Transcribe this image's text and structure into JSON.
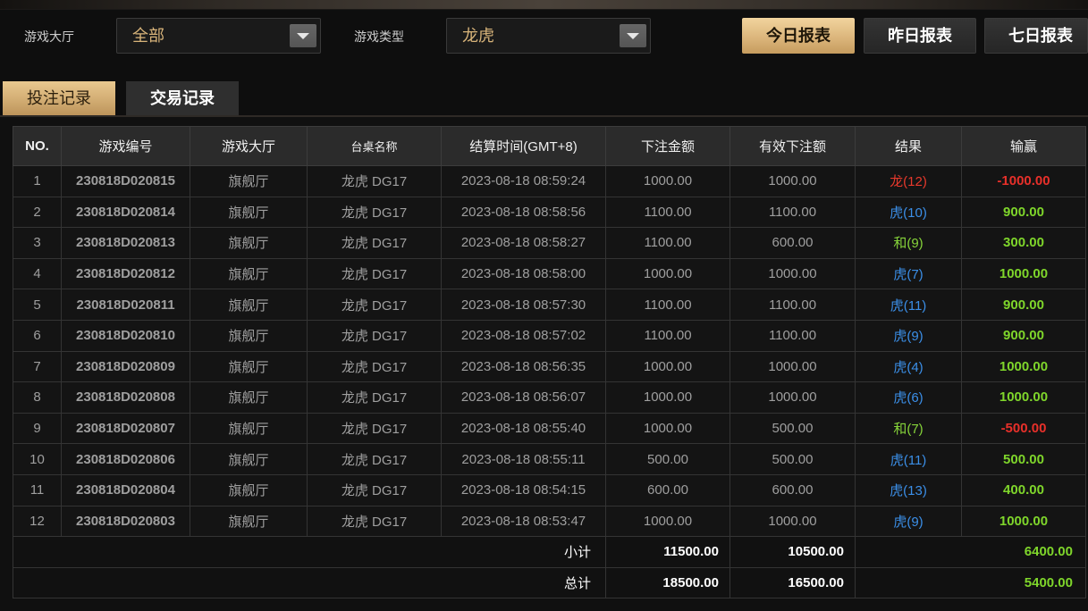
{
  "top_filters": {
    "hall_label": "游戏大厅",
    "hall_value": "全部",
    "type_label": "游戏类型",
    "type_value": "龙虎"
  },
  "report_buttons": {
    "today": "今日报表",
    "yesterday": "昨日报表",
    "seven_days": "七日报表"
  },
  "tabs": [
    {
      "label": "投注记录",
      "active": true
    },
    {
      "label": "交易记录",
      "active": false
    }
  ],
  "table": {
    "columns": [
      "NO.",
      "游戏编号",
      "游戏大厅",
      "台桌名称",
      "结算时间(GMT+8)",
      "下注金额",
      "有效下注额",
      "结果",
      "输赢"
    ],
    "rows": [
      {
        "no": "1",
        "game_id": "230818D020815",
        "hall": "旗舰厅",
        "table": "龙虎 DG17",
        "time": "2023-08-18 08:59:24",
        "bet": "1000.00",
        "valid_bet": "1000.00",
        "result": "龙(12)",
        "win_loss": "-1000.00"
      },
      {
        "no": "2",
        "game_id": "230818D020814",
        "hall": "旗舰厅",
        "table": "龙虎 DG17",
        "time": "2023-08-18 08:58:56",
        "bet": "1100.00",
        "valid_bet": "1100.00",
        "result": "虎(10)",
        "win_loss": "900.00"
      },
      {
        "no": "3",
        "game_id": "230818D020813",
        "hall": "旗舰厅",
        "table": "龙虎 DG17",
        "time": "2023-08-18 08:58:27",
        "bet": "1100.00",
        "valid_bet": "600.00",
        "result": "和(9)",
        "win_loss": "300.00"
      },
      {
        "no": "4",
        "game_id": "230818D020812",
        "hall": "旗舰厅",
        "table": "龙虎 DG17",
        "time": "2023-08-18 08:58:00",
        "bet": "1000.00",
        "valid_bet": "1000.00",
        "result": "虎(7)",
        "win_loss": "1000.00"
      },
      {
        "no": "5",
        "game_id": "230818D020811",
        "hall": "旗舰厅",
        "table": "龙虎 DG17",
        "time": "2023-08-18 08:57:30",
        "bet": "1100.00",
        "valid_bet": "1100.00",
        "result": "虎(11)",
        "win_loss": "900.00"
      },
      {
        "no": "6",
        "game_id": "230818D020810",
        "hall": "旗舰厅",
        "table": "龙虎 DG17",
        "time": "2023-08-18 08:57:02",
        "bet": "1100.00",
        "valid_bet": "1100.00",
        "result": "虎(9)",
        "win_loss": "900.00"
      },
      {
        "no": "7",
        "game_id": "230818D020809",
        "hall": "旗舰厅",
        "table": "龙虎 DG17",
        "time": "2023-08-18 08:56:35",
        "bet": "1000.00",
        "valid_bet": "1000.00",
        "result": "虎(4)",
        "win_loss": "1000.00"
      },
      {
        "no": "8",
        "game_id": "230818D020808",
        "hall": "旗舰厅",
        "table": "龙虎 DG17",
        "time": "2023-08-18 08:56:07",
        "bet": "1000.00",
        "valid_bet": "1000.00",
        "result": "虎(6)",
        "win_loss": "1000.00"
      },
      {
        "no": "9",
        "game_id": "230818D020807",
        "hall": "旗舰厅",
        "table": "龙虎 DG17",
        "time": "2023-08-18 08:55:40",
        "bet": "1000.00",
        "valid_bet": "500.00",
        "result": "和(7)",
        "win_loss": "-500.00"
      },
      {
        "no": "10",
        "game_id": "230818D020806",
        "hall": "旗舰厅",
        "table": "龙虎 DG17",
        "time": "2023-08-18 08:55:11",
        "bet": "500.00",
        "valid_bet": "500.00",
        "result": "虎(11)",
        "win_loss": "500.00"
      },
      {
        "no": "11",
        "game_id": "230818D020804",
        "hall": "旗舰厅",
        "table": "龙虎 DG17",
        "time": "2023-08-18 08:54:15",
        "bet": "600.00",
        "valid_bet": "600.00",
        "result": "虎(13)",
        "win_loss": "400.00"
      },
      {
        "no": "12",
        "game_id": "230818D020803",
        "hall": "旗舰厅",
        "table": "龙虎 DG17",
        "time": "2023-08-18 08:53:47",
        "bet": "1000.00",
        "valid_bet": "1000.00",
        "result": "虎(9)",
        "win_loss": "1000.00"
      }
    ],
    "subtotal": {
      "label": "小计",
      "bet": "11500.00",
      "valid_bet": "10500.00",
      "win_loss": "6400.00"
    },
    "total": {
      "label": "总计",
      "bet": "18500.00",
      "valid_bet": "16500.00",
      "win_loss": "5400.00"
    }
  },
  "colors": {
    "accent_gold": "#d8b47a",
    "dragon": "#e6392c",
    "tiger": "#3b8fe8",
    "tie": "#86d43a",
    "win": "#7fd62b",
    "loss": "#e8302a"
  },
  "icons": {
    "select_arrow": "chevron-down-icon"
  }
}
